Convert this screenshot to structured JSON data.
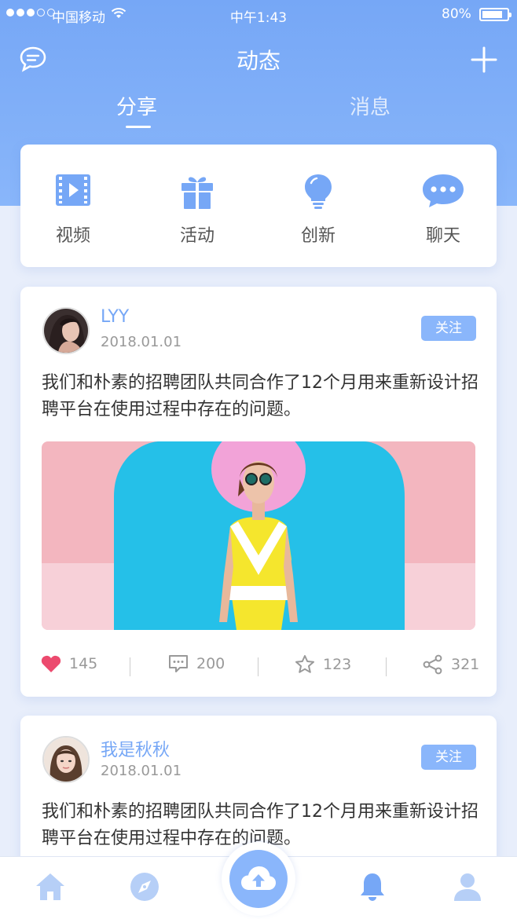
{
  "status_bar": {
    "carrier": "中国移动",
    "time": "中午1:43",
    "battery": "80%"
  },
  "nav": {
    "title": "动态",
    "tabs": [
      {
        "label": "分享",
        "active": true
      },
      {
        "label": "消息",
        "active": false
      }
    ]
  },
  "quick_actions": [
    {
      "label": "视频",
      "icon": "video-icon"
    },
    {
      "label": "活动",
      "icon": "gift-icon"
    },
    {
      "label": "创新",
      "icon": "lightbulb-icon"
    },
    {
      "label": "聊天",
      "icon": "chat-bubble-icon"
    }
  ],
  "posts": [
    {
      "username": "LYY",
      "date": "2018.01.01",
      "follow_label": "关注",
      "text": "我们和朴素的招聘团队共同合作了12个月用来重新设计招聘平台在使用过程中存在的问题。",
      "likes": "145",
      "comments": "200",
      "stars": "123",
      "shares": "321"
    },
    {
      "username": "我是秋秋",
      "date": "2018.01.01",
      "follow_label": "关注",
      "text": "我们和朴素的招聘团队共同合作了12个月用来重新设计招聘平台在使用过程中存在的问题。"
    }
  ],
  "colors": {
    "accent": "#76a7f6",
    "like": "#ec4a6e",
    "background": "#e8eefb"
  },
  "bottom_tabs": [
    "home-icon",
    "compass-icon",
    "upload-cloud-icon",
    "bell-icon",
    "profile-icon"
  ]
}
